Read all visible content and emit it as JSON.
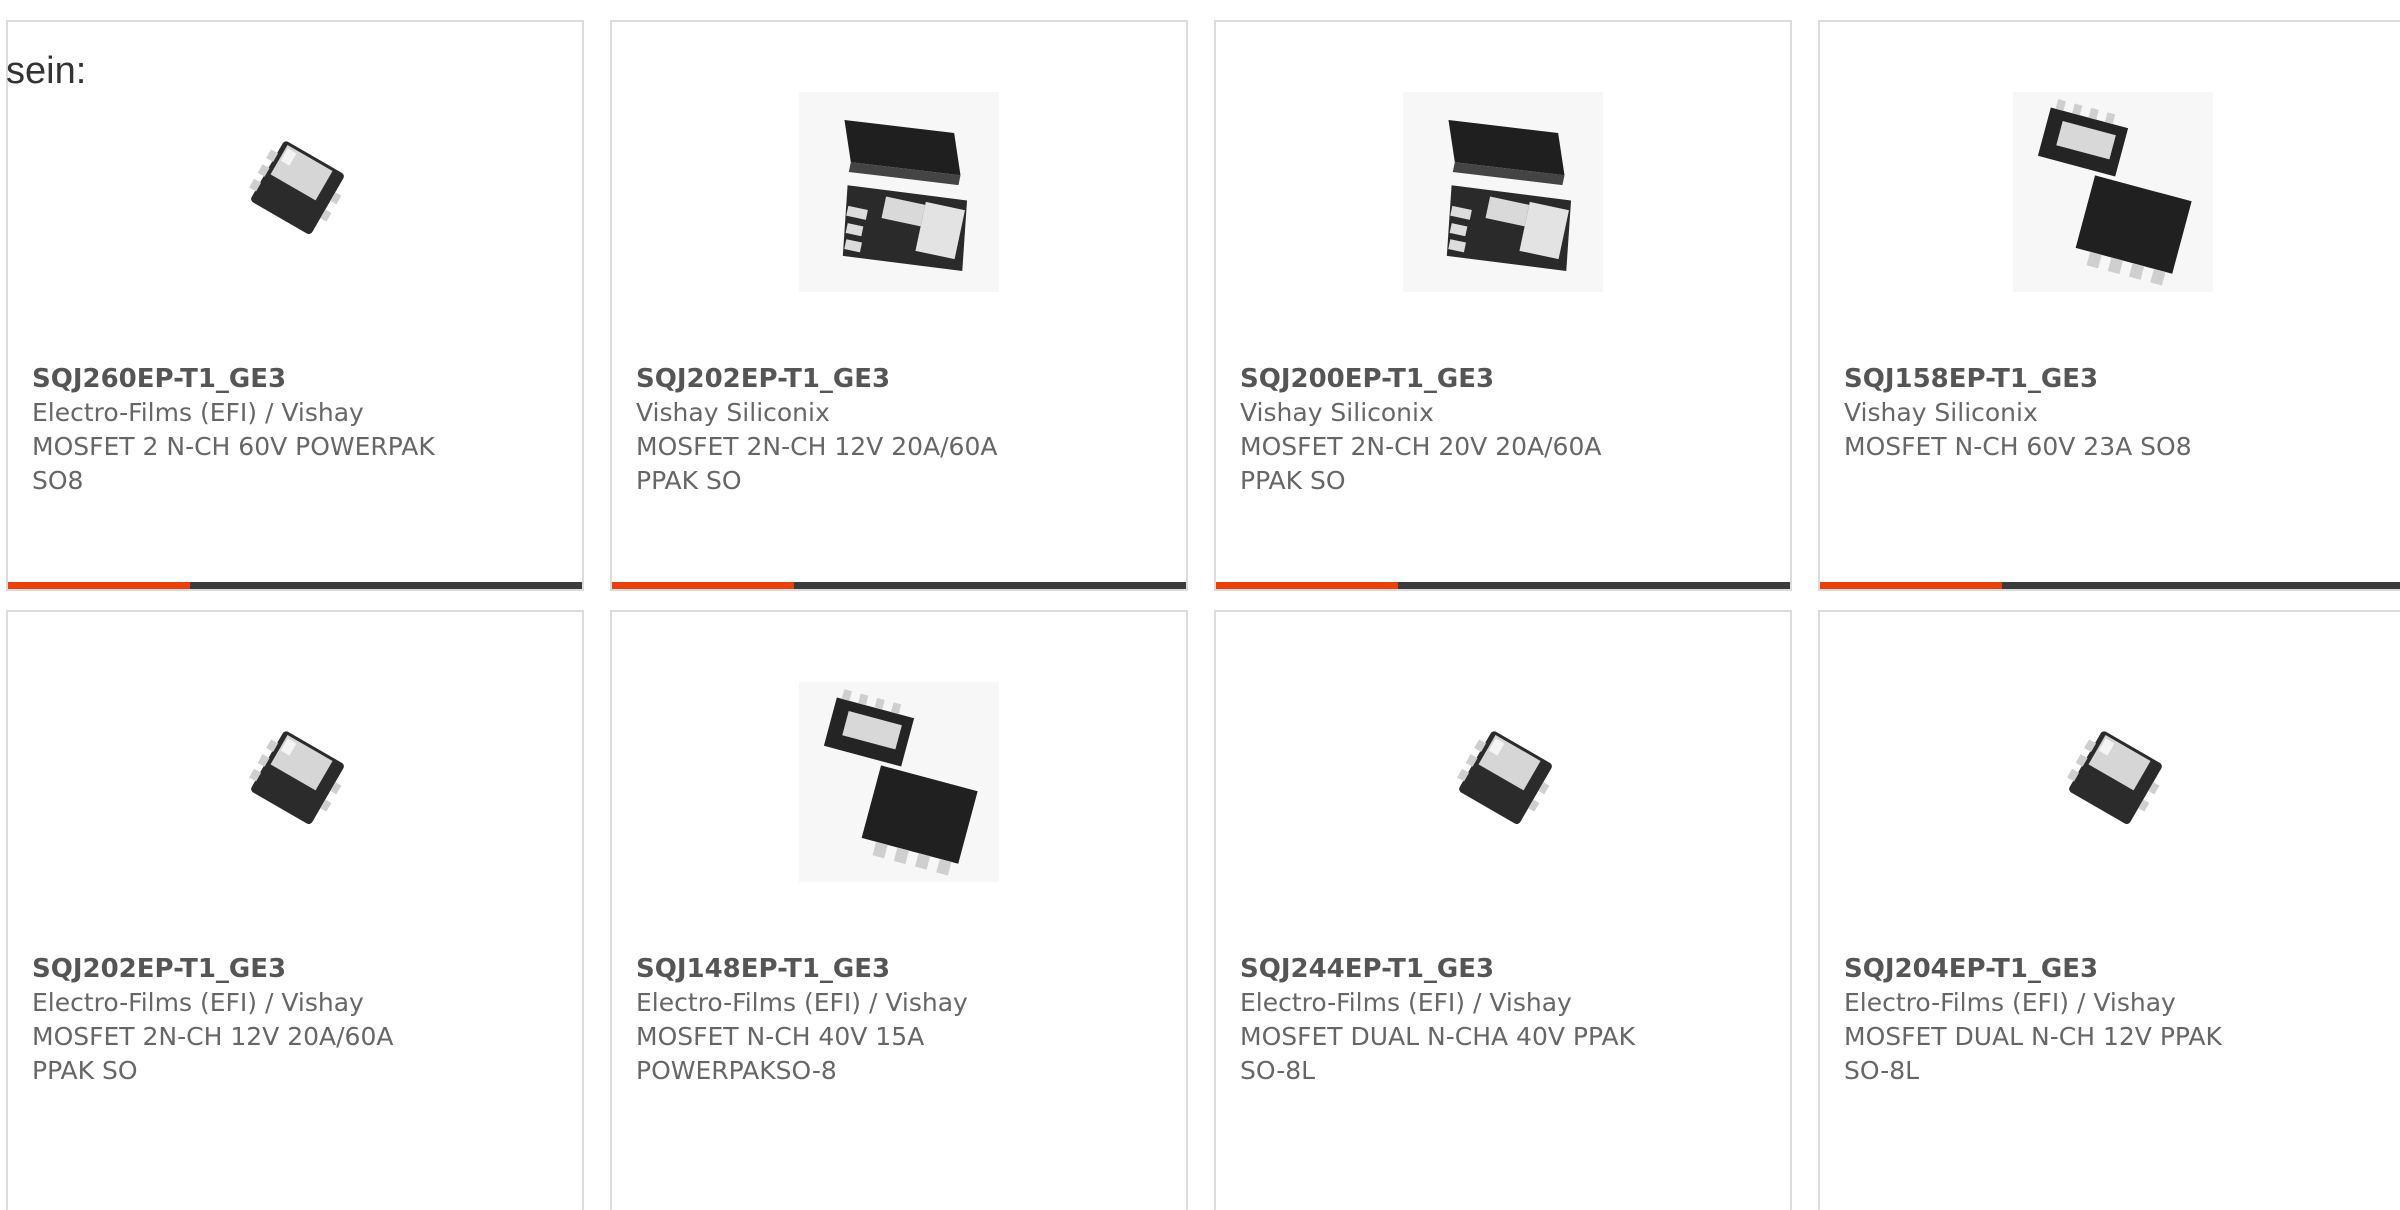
{
  "intro_text": "sein:",
  "colors": {
    "accent": "#e8410c",
    "bar_dark": "#3b3b3b",
    "border": "#dcdcdc",
    "text": "#666666"
  },
  "products": [
    {
      "part_number": "SQJ260EP-T1_GE3",
      "manufacturer": "Electro-Films (EFI) / Vishay",
      "description": "MOSFET 2 N-CH 60V POWERPAK\nSO8",
      "image": "mosfet-single-package-icon"
    },
    {
      "part_number": "SQJ202EP-T1_GE3",
      "manufacturer": "Vishay Siliconix",
      "description": "MOSFET 2N-CH 12V 20A/60A\nPPAK SO",
      "image": "mosfet-dual-view-package-icon"
    },
    {
      "part_number": "SQJ200EP-T1_GE3",
      "manufacturer": "Vishay Siliconix",
      "description": "MOSFET 2N-CH 20V 20A/60A\nPPAK SO",
      "image": "mosfet-dual-view-package-icon"
    },
    {
      "part_number": "SQJ158EP-T1_GE3",
      "manufacturer": "Vishay Siliconix",
      "description": "MOSFET N-CH 60V 23A SO8",
      "image": "mosfet-top-bottom-package-icon"
    },
    {
      "part_number": "SQJ202EP-T1_GE3",
      "manufacturer": "Electro-Films (EFI) / Vishay",
      "description": "MOSFET 2N-CH 12V 20A/60A\nPPAK SO",
      "image": "mosfet-single-package-icon"
    },
    {
      "part_number": "SQJ148EP-T1_GE3",
      "manufacturer": "Electro-Films (EFI) / Vishay",
      "description": "MOSFET N-CH 40V 15A\nPOWERPAKSO-8",
      "image": "mosfet-top-bottom-package-icon"
    },
    {
      "part_number": "SQJ244EP-T1_GE3",
      "manufacturer": "Electro-Films (EFI) / Vishay",
      "description": "MOSFET DUAL N-CHA 40V PPAK\nSO-8L",
      "image": "mosfet-single-package-icon"
    },
    {
      "part_number": "SQJ204EP-T1_GE3",
      "manufacturer": "Electro-Films (EFI) / Vishay",
      "description": "MOSFET DUAL N-CH 12V PPAK\nSO-8L",
      "image": "mosfet-single-package-icon"
    }
  ]
}
